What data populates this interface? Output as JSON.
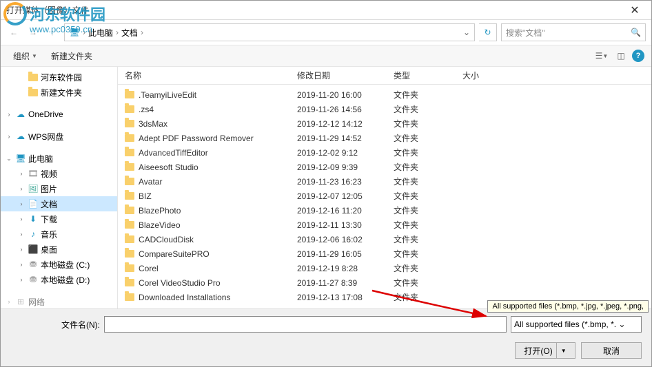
{
  "title": "打开媒体（图像）文件",
  "watermark": {
    "text": "河东软件园",
    "url": "www.pc0359.cn"
  },
  "breadcrumb": {
    "root": "此电脑",
    "current": "文档"
  },
  "search": {
    "placeholder": "搜索\"文档\""
  },
  "toolbar": {
    "organize": "组织",
    "newfolder": "新建文件夹"
  },
  "sidebar": [
    {
      "indent": 1,
      "chev": "",
      "icon": "folder",
      "label": "河东软件园"
    },
    {
      "indent": 1,
      "chev": "",
      "icon": "folder",
      "label": "新建文件夹"
    },
    {
      "indent": 0,
      "chev": "›",
      "icon": "onedrive",
      "label": "OneDrive",
      "spaceBefore": true
    },
    {
      "indent": 0,
      "chev": "›",
      "icon": "wps",
      "label": "WPS网盘",
      "spaceBefore": true
    },
    {
      "indent": 0,
      "chev": "⌄",
      "icon": "pc",
      "label": "此电脑",
      "spaceBefore": true
    },
    {
      "indent": 1,
      "chev": "›",
      "icon": "video",
      "label": "视频"
    },
    {
      "indent": 1,
      "chev": "›",
      "icon": "pictures",
      "label": "图片"
    },
    {
      "indent": 1,
      "chev": "›",
      "icon": "doc",
      "label": "文档",
      "selected": true
    },
    {
      "indent": 1,
      "chev": "›",
      "icon": "download",
      "label": "下载"
    },
    {
      "indent": 1,
      "chev": "›",
      "icon": "music",
      "label": "音乐"
    },
    {
      "indent": 1,
      "chev": "›",
      "icon": "desktop",
      "label": "桌面"
    },
    {
      "indent": 1,
      "chev": "›",
      "icon": "disk",
      "label": "本地磁盘 (C:)"
    },
    {
      "indent": 1,
      "chev": "›",
      "icon": "disk",
      "label": "本地磁盘 (D:)"
    },
    {
      "indent": 0,
      "chev": "›",
      "icon": "network",
      "label": "网络",
      "spaceBefore": true,
      "faded": true
    }
  ],
  "columns": {
    "name": "名称",
    "date": "修改日期",
    "type": "类型",
    "size": "大小"
  },
  "files": [
    {
      "name": ".TeamyiLiveEdit",
      "date": "2019-11-20 16:00",
      "type": "文件夹"
    },
    {
      "name": ".zs4",
      "date": "2019-11-26 14:56",
      "type": "文件夹"
    },
    {
      "name": "3dsMax",
      "date": "2019-12-12 14:12",
      "type": "文件夹"
    },
    {
      "name": "Adept PDF Password Remover",
      "date": "2019-11-29 14:52",
      "type": "文件夹"
    },
    {
      "name": "AdvancedTiffEditor",
      "date": "2019-12-02 9:12",
      "type": "文件夹"
    },
    {
      "name": "Aiseesoft Studio",
      "date": "2019-12-09 9:39",
      "type": "文件夹"
    },
    {
      "name": "Avatar",
      "date": "2019-11-23 16:23",
      "type": "文件夹"
    },
    {
      "name": "BIZ",
      "date": "2019-12-07 12:05",
      "type": "文件夹"
    },
    {
      "name": "BlazePhoto",
      "date": "2019-12-16 11:20",
      "type": "文件夹"
    },
    {
      "name": "BlazeVideo",
      "date": "2019-12-11 13:30",
      "type": "文件夹"
    },
    {
      "name": "CADCloudDisk",
      "date": "2019-12-06 16:02",
      "type": "文件夹"
    },
    {
      "name": "CompareSuitePRO",
      "date": "2019-11-29 16:05",
      "type": "文件夹"
    },
    {
      "name": "Corel",
      "date": "2019-12-19 8:28",
      "type": "文件夹"
    },
    {
      "name": "Corel VideoStudio Pro",
      "date": "2019-11-27 8:39",
      "type": "文件夹"
    },
    {
      "name": "Downloaded Installations",
      "date": "2019-12-13 17:08",
      "type": "文件夹"
    }
  ],
  "tooltip": "All supported files (*.bmp, *.jpg, *.jpeg, *.png,",
  "bottom": {
    "filename_label": "文件名(N):",
    "filter": "All supported files (*.bmp, *. ⌄",
    "open": "打开(O)",
    "cancel": "取消"
  }
}
